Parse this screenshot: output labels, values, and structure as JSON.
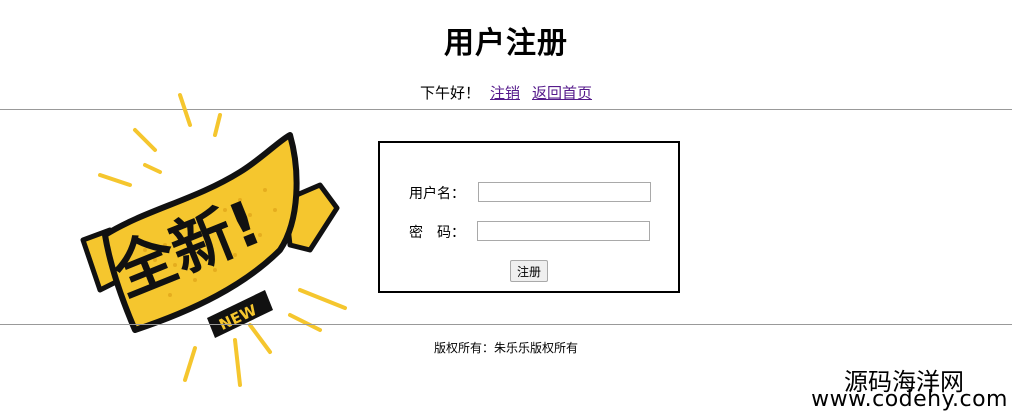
{
  "page": {
    "title": "用户注册"
  },
  "nav": {
    "greeting": "下午好！",
    "logout_label": "注销",
    "home_label": "返回首页"
  },
  "badge": {
    "main_text": "全新!",
    "sub_text": "NEW",
    "colors": {
      "yellow": "#f5c62e",
      "black": "#111111"
    }
  },
  "form": {
    "username_label": "用户名：",
    "username_value": "",
    "password_label": "密　码：",
    "password_value": "",
    "submit_label": "注册"
  },
  "footer": {
    "copyright": "版权所有：朱乐乐版权所有"
  },
  "watermark": {
    "line1": "源码海洋网",
    "line2": "www.codehy.com"
  }
}
